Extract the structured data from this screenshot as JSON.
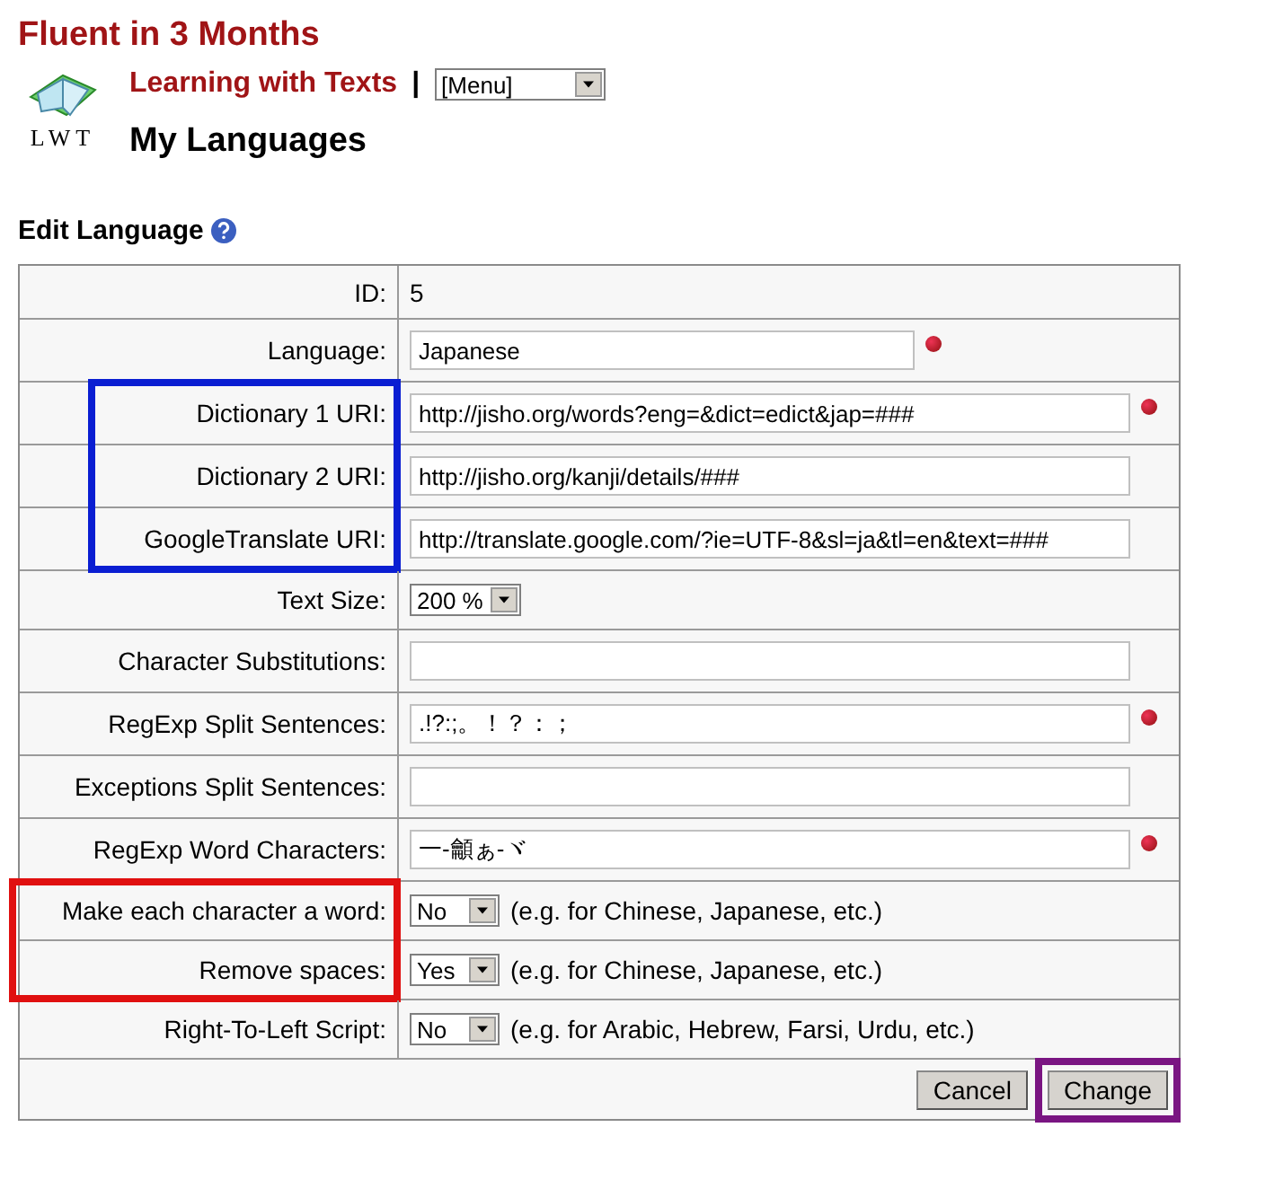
{
  "site_title": "Fluent in 3 Months",
  "logo": {
    "text": "LWT"
  },
  "app_link": "Learning with Texts",
  "separator": "|",
  "menu_select": {
    "value": "[Menu]"
  },
  "page_title": "My Languages",
  "section_title": "Edit Language",
  "rows": [
    {
      "kind": "static",
      "label": "ID:",
      "value": "5",
      "required": false
    },
    {
      "kind": "text",
      "label": "Language:",
      "value": "Japanese",
      "required": true,
      "wide": false
    },
    {
      "kind": "text",
      "label": "Dictionary 1 URI:",
      "value": "http://jisho.org/words?eng=&dict=edict&jap=###",
      "required": true,
      "wide": true,
      "color": "#0a1ed2"
    },
    {
      "kind": "text",
      "label": "Dictionary 2 URI:",
      "value": "http://jisho.org/kanji/details/###",
      "required": false,
      "wide": true,
      "color": "#0a1ed2"
    },
    {
      "kind": "text",
      "label": "GoogleTranslate URI:",
      "value": "http://translate.google.com/?ie=UTF-8&sl=ja&tl=en&text=###",
      "required": false,
      "wide": true,
      "color": "#0a1ed2"
    },
    {
      "kind": "select",
      "label": "Text Size:",
      "value": "200 %",
      "required": false
    },
    {
      "kind": "text",
      "label": "Character Substitutions:",
      "value": "",
      "required": false,
      "wide": true
    },
    {
      "kind": "text",
      "label": "RegExp Split Sentences:",
      "value": ".!?:;。！？：；",
      "required": true,
      "wide": true
    },
    {
      "kind": "text",
      "label": "Exceptions Split Sentences:",
      "value": "",
      "required": false,
      "wide": true
    },
    {
      "kind": "text",
      "label": "RegExp Word Characters:",
      "value": "一-龥ぁ-ヾ",
      "required": true,
      "wide": true
    },
    {
      "kind": "select",
      "label": "Make each character a word:",
      "value": "No",
      "note": "(e.g. for Chinese, Japanese, etc.)",
      "required": false,
      "color": "#e01010"
    },
    {
      "kind": "select",
      "label": "Remove spaces:",
      "value": "Yes",
      "note": "(e.g. for Chinese, Japanese, etc.)",
      "required": false,
      "color": "#e01010"
    },
    {
      "kind": "select",
      "label": "Right-To-Left Script:",
      "value": "No",
      "note": "(e.g. for Arabic, Hebrew, Farsi, Urdu, etc.)",
      "required": false
    }
  ],
  "buttons": [
    {
      "label": "Cancel"
    },
    {
      "label": "Change",
      "color": "#7a1582"
    }
  ]
}
